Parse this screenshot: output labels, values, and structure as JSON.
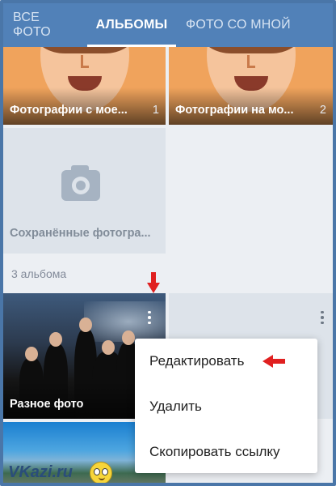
{
  "tabs": [
    {
      "label": "ВСЕ ФОТО",
      "active": false
    },
    {
      "label": "АЛЬБОМЫ",
      "active": true
    },
    {
      "label": "ФОТО СО МНОЙ",
      "active": false
    }
  ],
  "albums_top": [
    {
      "title": "Фотографии с мое...",
      "count": "1"
    },
    {
      "title": "Фотографии на мо...",
      "count": "2"
    }
  ],
  "saved": {
    "title": "Сохранённые фотогра...",
    "icon": "camera-icon"
  },
  "section": {
    "label": "3 альбома"
  },
  "photo_album": {
    "title": "Разное фото",
    "menu_icon": "kebab-menu-icon"
  },
  "second_album": {
    "menu_icon": "kebab-menu-icon"
  },
  "menu": {
    "edit": "Редактировать",
    "delete": "Удалить",
    "copy_link": "Скопировать ссылку"
  },
  "watermark": {
    "text": "VKazi.ru"
  },
  "colors": {
    "header": "#5181b8",
    "annotation_red": "#e02020",
    "frame": "#4a76a8"
  }
}
